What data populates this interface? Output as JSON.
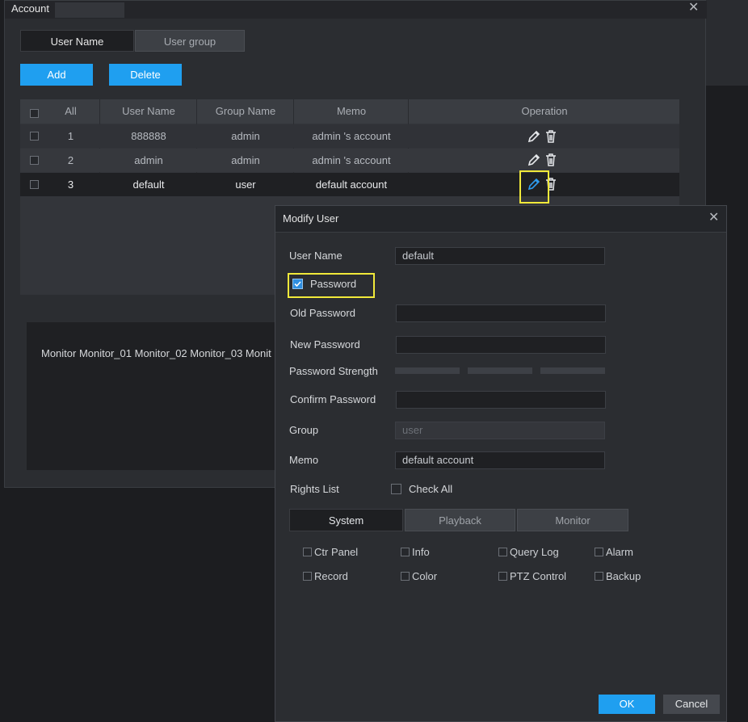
{
  "account_window": {
    "title": "Account",
    "tabs": [
      "User Name",
      "User group"
    ],
    "add_label": "Add",
    "delete_label": "Delete",
    "table": {
      "columns": [
        "All",
        "User Name",
        "Group Name",
        "Memo",
        "Operation"
      ],
      "rows": [
        {
          "index": "1",
          "user_name": "888888",
          "group": "admin",
          "memo": "admin 's account"
        },
        {
          "index": "2",
          "user_name": "admin",
          "group": "admin",
          "memo": "admin 's account"
        },
        {
          "index": "3",
          "user_name": "default",
          "group": "user",
          "memo": "default account"
        }
      ]
    },
    "monitor_list": "Monitor  Monitor_01  Monitor_02  Monitor_03  Monit"
  },
  "modify_user": {
    "title": "Modify User",
    "user_name_label": "User Name",
    "user_name_value": "default",
    "password_label": "Password",
    "old_password_label": "Old Password",
    "new_password_label": "New Password",
    "password_strength_label": "Password Strength",
    "confirm_password_label": "Confirm Password",
    "group_label": "Group",
    "group_value": "user",
    "memo_label": "Memo",
    "memo_value": "default account",
    "rights_list_label": "Rights List",
    "check_all_label": "Check All",
    "tabs": [
      "System",
      "Playback",
      "Monitor"
    ],
    "permissions": [
      "Ctr Panel",
      "Info",
      "Query Log",
      "Alarm",
      "Record",
      "Color",
      "PTZ Control",
      "Backup"
    ],
    "ok_label": "OK",
    "cancel_label": "Cancel"
  },
  "colors": {
    "accent": "#1f9ff0",
    "highlight": "#f1e93a",
    "background": "#2b2d31"
  },
  "icons": [
    "close-icon",
    "edit-icon",
    "delete-icon",
    "checkbox-icon"
  ]
}
